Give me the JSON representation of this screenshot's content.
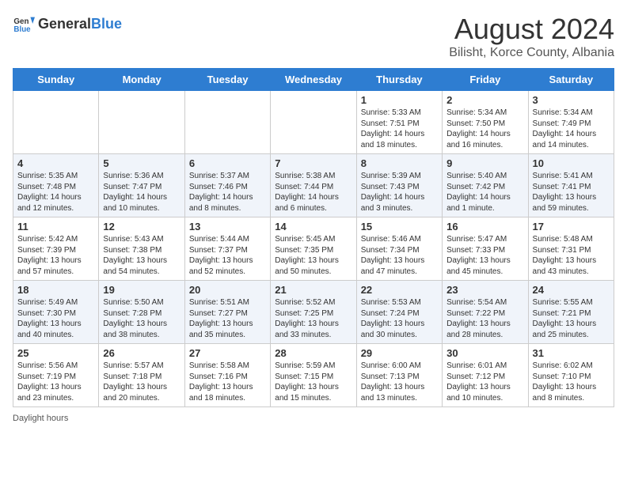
{
  "header": {
    "logo_general": "General",
    "logo_blue": "Blue",
    "title": "August 2024",
    "subtitle": "Bilisht, Korce County, Albania"
  },
  "days_of_week": [
    "Sunday",
    "Monday",
    "Tuesday",
    "Wednesday",
    "Thursday",
    "Friday",
    "Saturday"
  ],
  "weeks": [
    [
      {
        "day": "",
        "text": ""
      },
      {
        "day": "",
        "text": ""
      },
      {
        "day": "",
        "text": ""
      },
      {
        "day": "",
        "text": ""
      },
      {
        "day": "1",
        "text": "Sunrise: 5:33 AM\nSunset: 7:51 PM\nDaylight: 14 hours\nand 18 minutes."
      },
      {
        "day": "2",
        "text": "Sunrise: 5:34 AM\nSunset: 7:50 PM\nDaylight: 14 hours\nand 16 minutes."
      },
      {
        "day": "3",
        "text": "Sunrise: 5:34 AM\nSunset: 7:49 PM\nDaylight: 14 hours\nand 14 minutes."
      }
    ],
    [
      {
        "day": "4",
        "text": "Sunrise: 5:35 AM\nSunset: 7:48 PM\nDaylight: 14 hours\nand 12 minutes."
      },
      {
        "day": "5",
        "text": "Sunrise: 5:36 AM\nSunset: 7:47 PM\nDaylight: 14 hours\nand 10 minutes."
      },
      {
        "day": "6",
        "text": "Sunrise: 5:37 AM\nSunset: 7:46 PM\nDaylight: 14 hours\nand 8 minutes."
      },
      {
        "day": "7",
        "text": "Sunrise: 5:38 AM\nSunset: 7:44 PM\nDaylight: 14 hours\nand 6 minutes."
      },
      {
        "day": "8",
        "text": "Sunrise: 5:39 AM\nSunset: 7:43 PM\nDaylight: 14 hours\nand 3 minutes."
      },
      {
        "day": "9",
        "text": "Sunrise: 5:40 AM\nSunset: 7:42 PM\nDaylight: 14 hours\nand 1 minute."
      },
      {
        "day": "10",
        "text": "Sunrise: 5:41 AM\nSunset: 7:41 PM\nDaylight: 13 hours\nand 59 minutes."
      }
    ],
    [
      {
        "day": "11",
        "text": "Sunrise: 5:42 AM\nSunset: 7:39 PM\nDaylight: 13 hours\nand 57 minutes."
      },
      {
        "day": "12",
        "text": "Sunrise: 5:43 AM\nSunset: 7:38 PM\nDaylight: 13 hours\nand 54 minutes."
      },
      {
        "day": "13",
        "text": "Sunrise: 5:44 AM\nSunset: 7:37 PM\nDaylight: 13 hours\nand 52 minutes."
      },
      {
        "day": "14",
        "text": "Sunrise: 5:45 AM\nSunset: 7:35 PM\nDaylight: 13 hours\nand 50 minutes."
      },
      {
        "day": "15",
        "text": "Sunrise: 5:46 AM\nSunset: 7:34 PM\nDaylight: 13 hours\nand 47 minutes."
      },
      {
        "day": "16",
        "text": "Sunrise: 5:47 AM\nSunset: 7:33 PM\nDaylight: 13 hours\nand 45 minutes."
      },
      {
        "day": "17",
        "text": "Sunrise: 5:48 AM\nSunset: 7:31 PM\nDaylight: 13 hours\nand 43 minutes."
      }
    ],
    [
      {
        "day": "18",
        "text": "Sunrise: 5:49 AM\nSunset: 7:30 PM\nDaylight: 13 hours\nand 40 minutes."
      },
      {
        "day": "19",
        "text": "Sunrise: 5:50 AM\nSunset: 7:28 PM\nDaylight: 13 hours\nand 38 minutes."
      },
      {
        "day": "20",
        "text": "Sunrise: 5:51 AM\nSunset: 7:27 PM\nDaylight: 13 hours\nand 35 minutes."
      },
      {
        "day": "21",
        "text": "Sunrise: 5:52 AM\nSunset: 7:25 PM\nDaylight: 13 hours\nand 33 minutes."
      },
      {
        "day": "22",
        "text": "Sunrise: 5:53 AM\nSunset: 7:24 PM\nDaylight: 13 hours\nand 30 minutes."
      },
      {
        "day": "23",
        "text": "Sunrise: 5:54 AM\nSunset: 7:22 PM\nDaylight: 13 hours\nand 28 minutes."
      },
      {
        "day": "24",
        "text": "Sunrise: 5:55 AM\nSunset: 7:21 PM\nDaylight: 13 hours\nand 25 minutes."
      }
    ],
    [
      {
        "day": "25",
        "text": "Sunrise: 5:56 AM\nSunset: 7:19 PM\nDaylight: 13 hours\nand 23 minutes."
      },
      {
        "day": "26",
        "text": "Sunrise: 5:57 AM\nSunset: 7:18 PM\nDaylight: 13 hours\nand 20 minutes."
      },
      {
        "day": "27",
        "text": "Sunrise: 5:58 AM\nSunset: 7:16 PM\nDaylight: 13 hours\nand 18 minutes."
      },
      {
        "day": "28",
        "text": "Sunrise: 5:59 AM\nSunset: 7:15 PM\nDaylight: 13 hours\nand 15 minutes."
      },
      {
        "day": "29",
        "text": "Sunrise: 6:00 AM\nSunset: 7:13 PM\nDaylight: 13 hours\nand 13 minutes."
      },
      {
        "day": "30",
        "text": "Sunrise: 6:01 AM\nSunset: 7:12 PM\nDaylight: 13 hours\nand 10 minutes."
      },
      {
        "day": "31",
        "text": "Sunrise: 6:02 AM\nSunset: 7:10 PM\nDaylight: 13 hours\nand 8 minutes."
      }
    ]
  ],
  "footer": {
    "daylight_label": "Daylight hours"
  }
}
